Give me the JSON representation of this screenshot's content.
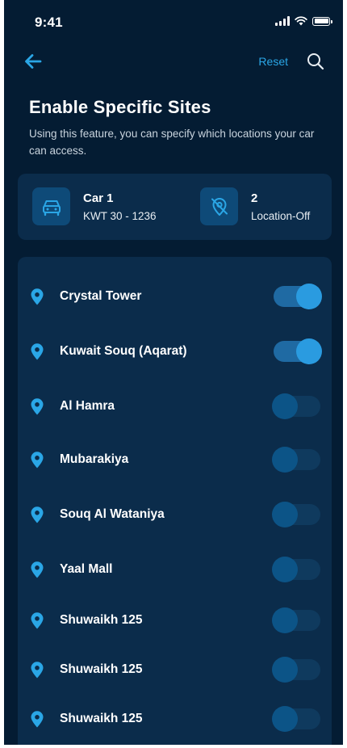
{
  "status_bar": {
    "time": "9:41"
  },
  "nav": {
    "reset_label": "Reset",
    "back_icon": "arrow-left-icon",
    "search_icon": "search-icon"
  },
  "header": {
    "title": "Enable Specific Sites",
    "subtitle": "Using this feature, you can specify which locations your car can access."
  },
  "car_info": {
    "car_name": "Car 1",
    "plate": "KWT  30 - 1236",
    "car_icon": "car-icon",
    "location_off_count": "2",
    "location_off_label": "Location-Off",
    "location_off_icon": "location-off-icon"
  },
  "sites": [
    {
      "name": "Crystal Tower",
      "enabled": true
    },
    {
      "name": "Kuwait Souq (Aqarat)",
      "enabled": true
    },
    {
      "name": "Al Hamra",
      "enabled": false
    },
    {
      "name": "Mubarakiya",
      "enabled": false
    },
    {
      "name": "Souq Al Wataniya",
      "enabled": false
    },
    {
      "name": "Yaal Mall",
      "enabled": false
    },
    {
      "name": "Shuwaikh 125",
      "enabled": false
    },
    {
      "name": "Shuwaikh 125",
      "enabled": false
    },
    {
      "name": "Shuwaikh 125",
      "enabled": false
    }
  ],
  "colors": {
    "background": "#041c33",
    "card": "#0b2c4b",
    "accent": "#2aa6e6",
    "toggle_on": "#2a9be0",
    "toggle_off": "#0c5487"
  }
}
